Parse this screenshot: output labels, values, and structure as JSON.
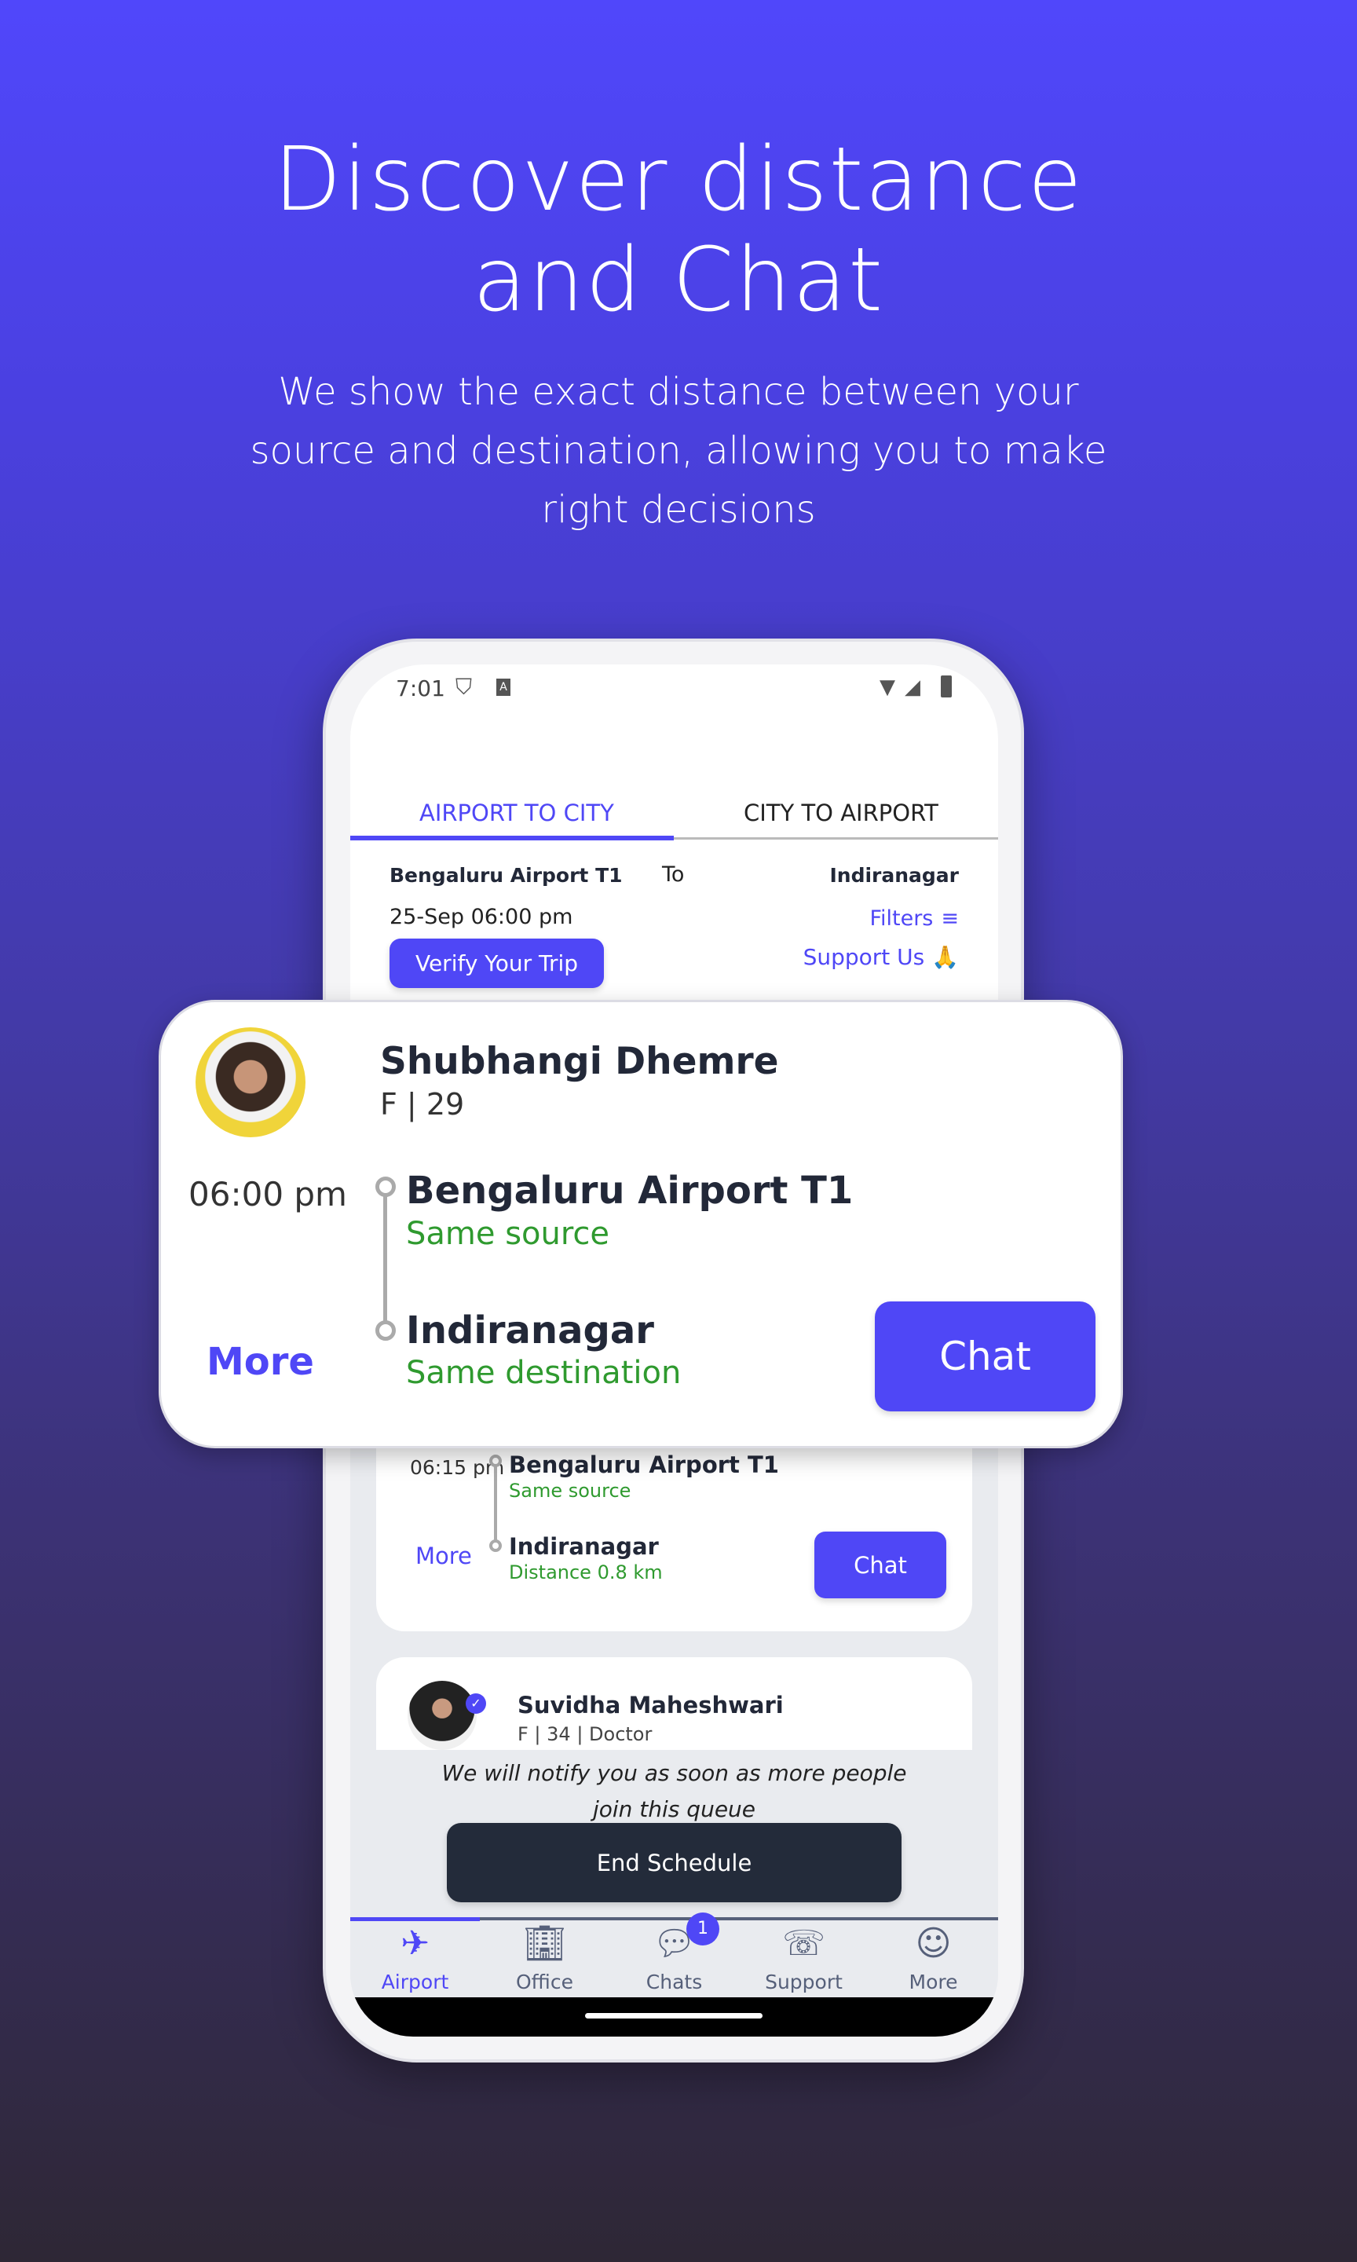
{
  "hero": {
    "title_line1": "Discover distance",
    "title_line2": "and Chat",
    "subtitle_line1": "We show the exact distance between your",
    "subtitle_line2": "source and destination, allowing you to make",
    "subtitle_line3": "right decisions"
  },
  "status_bar": {
    "time": "7:01"
  },
  "tabs": [
    {
      "label": "AIRPORT TO CITY",
      "active": true
    },
    {
      "label": "CITY TO AIRPORT",
      "active": false
    }
  ],
  "trip": {
    "source": "Bengaluru Airport T1",
    "to_label": "To",
    "destination": "Indiranagar",
    "datetime": "25-Sep 06:00 pm",
    "filters_label": "Filters",
    "verify_label": "Verify Your Trip",
    "support_label": "Support Us 🙏"
  },
  "featured_match": {
    "name": "Shubhangi Dhemre",
    "meta": "F | 29",
    "time": "06:00 pm",
    "source": "Bengaluru Airport T1",
    "source_note": "Same source",
    "destination": "Indiranagar",
    "destination_note": "Same destination",
    "more_label": "More",
    "chat_label": "Chat"
  },
  "matches": [
    {
      "time": "06:15 pm",
      "source": "Bengaluru Airport T1",
      "source_note": "Same source",
      "destination": "Indiranagar",
      "destination_note": "Distance 0.8 km",
      "more_label": "More",
      "chat_label": "Chat"
    },
    {
      "name": "Suvidha Maheshwari",
      "meta": "F | 34 | Doctor",
      "verified": true
    }
  ],
  "notice": {
    "line1": "We will notify you as soon as more people",
    "line2": "join this queue"
  },
  "end_schedule_label": "End Schedule",
  "bottom_nav": [
    {
      "label": "Airport",
      "icon": "airplane-icon",
      "active": true
    },
    {
      "label": "Office",
      "icon": "building-icon"
    },
    {
      "label": "Chats",
      "icon": "chat-bubble-icon",
      "badge": "1"
    },
    {
      "label": "Support",
      "icon": "headset-icon"
    },
    {
      "label": "More",
      "icon": "smile-icon"
    }
  ],
  "colors": {
    "accent": "#4f47f6",
    "success": "#2f9a2f",
    "dark_button": "#232b3a"
  }
}
